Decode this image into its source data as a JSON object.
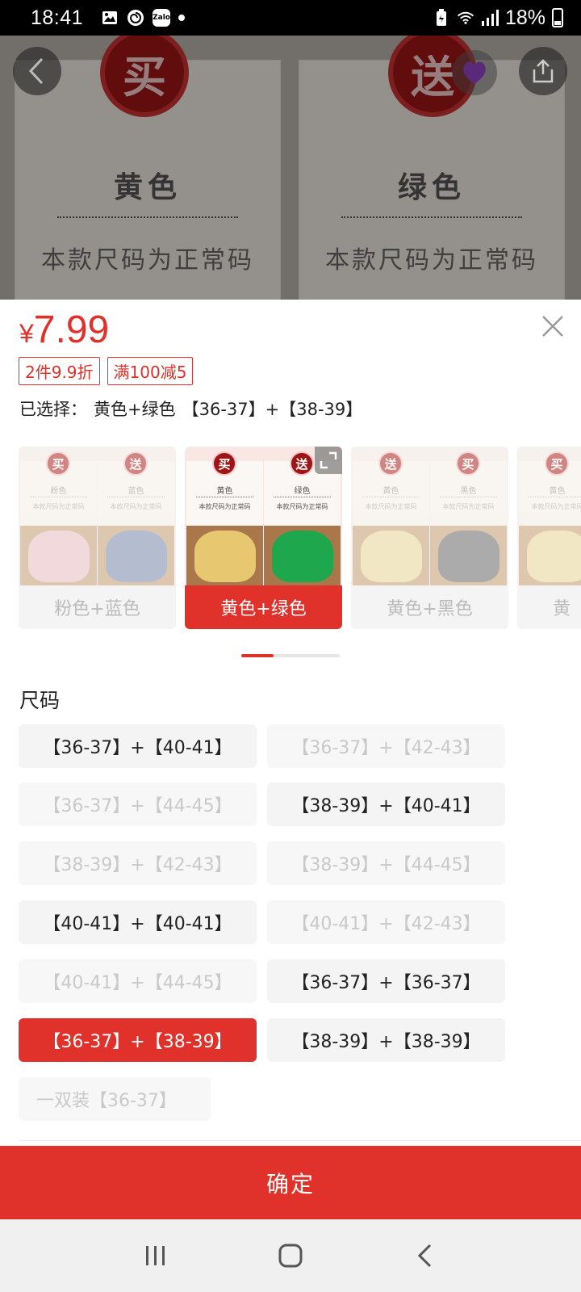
{
  "status_bar": {
    "time": "18:41",
    "battery_text": "18%",
    "left_icons": [
      "image-icon",
      "swirl-icon",
      "zalo-icon",
      "notification-dot"
    ],
    "zalo_text": "Zalo",
    "right_icons": [
      "battery-saver-icon",
      "wifi-icon",
      "signal-icon",
      "battery-icon"
    ]
  },
  "background_product": {
    "left": {
      "badge": "买",
      "color": "黄色",
      "desc": "本款尺码为正常码"
    },
    "right": {
      "badge": "送",
      "color": "绿色",
      "desc": "本款尺码为正常码"
    }
  },
  "sheet": {
    "currency": "¥",
    "price": "7.99",
    "tags": [
      "2件9.9折",
      "满100减5"
    ],
    "selected_label": "已选择：",
    "selected_color": "黄色+绿色",
    "selected_size": "【36-37】+【38-39】",
    "combos": [
      {
        "label": "粉色+蓝色",
        "left": {
          "badge": "买",
          "title": "粉色",
          "desc": "本款尺码为正常码",
          "shoe_color": "#f0c9cf"
        },
        "right": {
          "badge": "送",
          "title": "蓝色",
          "desc": "本款尺码为正常码",
          "shoe_color": "#7f93b8"
        }
      },
      {
        "label": "黄色+绿色",
        "left": {
          "badge": "买",
          "title": "黄色",
          "desc": "本款尺码为正常码",
          "shoe_color": "#e7c870"
        },
        "right": {
          "badge": "送",
          "title": "绿色",
          "desc": "本款尺码为正常码",
          "shoe_color": "#1fa74e"
        }
      },
      {
        "label": "黄色+黑色",
        "left": {
          "badge": "送",
          "title": "黄色",
          "desc": "本款尺码为正常码",
          "shoe_color": "#efe0a4"
        },
        "right": {
          "badge": "买",
          "title": "黑色",
          "desc": "本款尺码为正常码",
          "shoe_color": "#6f7378"
        }
      },
      {
        "label": "黄",
        "left": {
          "badge": "买",
          "title": "黄色",
          "desc": "本款尺码为正常码",
          "shoe_color": "#efe0a4"
        }
      }
    ],
    "size_title": "尺码",
    "sizes": [
      {
        "label": "【36-37】+【40-41】",
        "state": "normal"
      },
      {
        "label": "【36-37】+【42-43】",
        "state": "disabled"
      },
      {
        "label": "【36-37】+【44-45】",
        "state": "disabled"
      },
      {
        "label": "【38-39】+【40-41】",
        "state": "normal"
      },
      {
        "label": "【38-39】+【42-43】",
        "state": "disabled"
      },
      {
        "label": "【38-39】+【44-45】",
        "state": "disabled"
      },
      {
        "label": "【40-41】+【40-41】",
        "state": "normal"
      },
      {
        "label": "【40-41】+【42-43】",
        "state": "disabled"
      },
      {
        "label": "【40-41】+【44-45】",
        "state": "disabled"
      },
      {
        "label": "【36-37】+【36-37】",
        "state": "normal"
      },
      {
        "label": "【36-37】+【38-39】",
        "state": "active"
      },
      {
        "label": "【38-39】+【38-39】",
        "state": "normal"
      },
      {
        "label": "一双装【36-37】",
        "state": "disabled"
      }
    ],
    "confirm_label": "确定"
  },
  "colors": {
    "accent": "#e0312a",
    "badge_red": "#9d1515"
  },
  "nav": [
    "recent-apps-icon",
    "home-icon",
    "back-icon"
  ]
}
